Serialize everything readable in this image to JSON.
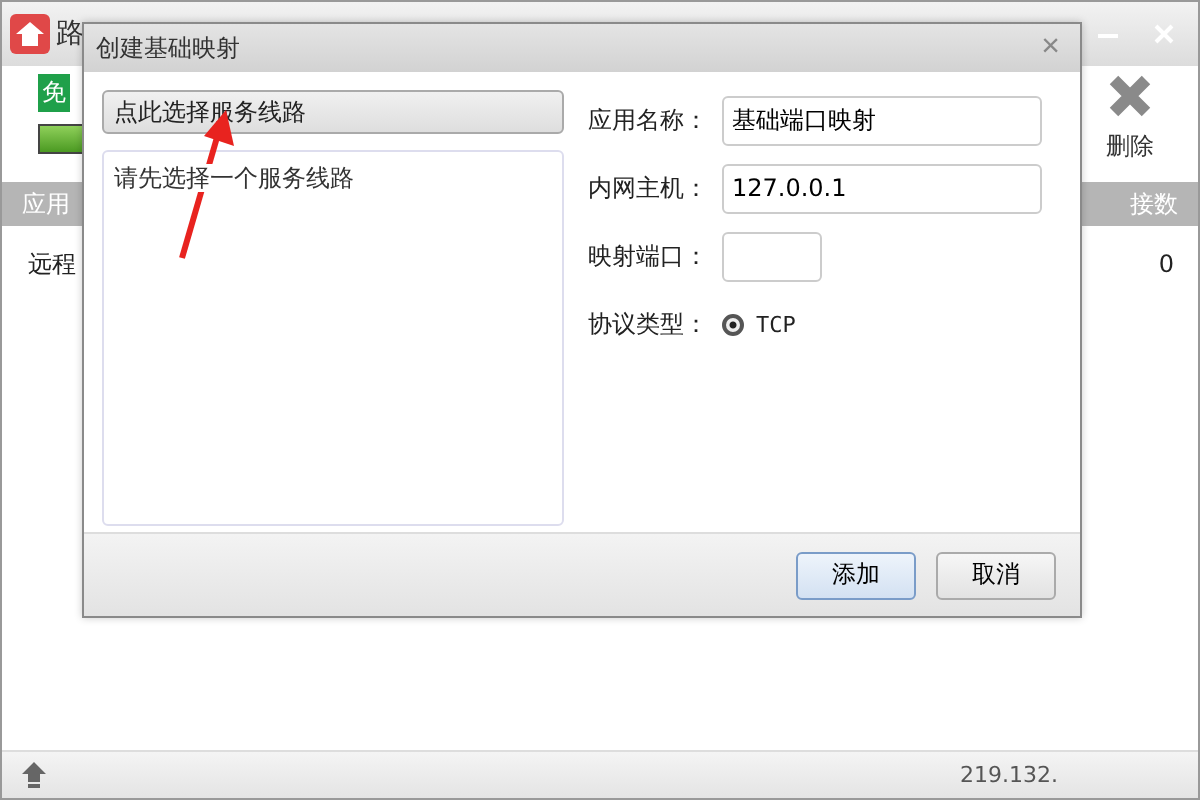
{
  "main_window": {
    "title": "路",
    "badge": "免",
    "toolbar": [
      {
        "label": "删除",
        "kind": "delete"
      }
    ],
    "table": {
      "columns": [
        "应用",
        "接数"
      ],
      "rows": [
        [
          "远程",
          "0"
        ]
      ]
    },
    "status_bar": {
      "address": "219.132."
    }
  },
  "dialog": {
    "title": "创建基础映射",
    "close": "×",
    "line_button": "点此选择服务线路",
    "line_list": {
      "placeholder": "请先选择一个服务线路"
    },
    "fields": [
      {
        "label": "应用名称：",
        "value": "基础端口映射",
        "kind": "text"
      },
      {
        "label": "内网主机：",
        "value": "127.0.0.1",
        "kind": "text"
      },
      {
        "label": "映射端口：",
        "kind": "port"
      },
      {
        "label": "协议类型：",
        "kind": "radio",
        "options": [
          {
            "label": "TCP",
            "selected": true
          }
        ]
      }
    ],
    "buttons": [
      {
        "label": "添加",
        "focused": true
      },
      {
        "label": "取消",
        "focused": false
      }
    ]
  }
}
